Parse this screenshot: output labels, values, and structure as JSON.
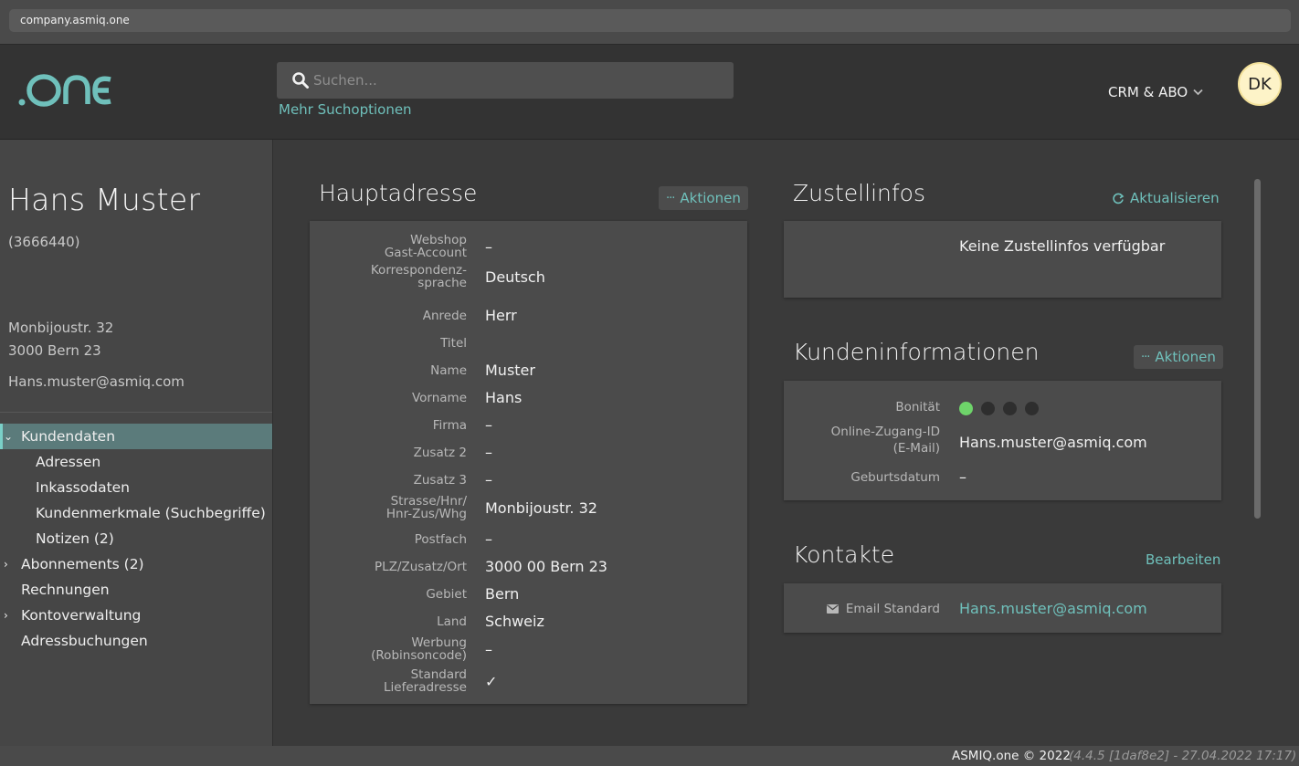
{
  "browser": {
    "url": "company.asmiq.one"
  },
  "header": {
    "logo_text": ".ONE",
    "search_placeholder": "Suchen...",
    "more_search": "Mehr Suchoptionen",
    "module": "CRM & ABO",
    "avatar_initials": "DK"
  },
  "customer": {
    "name": "Hans Muster",
    "id": "(3666440)",
    "street": "Monbijoustr. 32",
    "city": "3000 Bern 23",
    "email": "Hans.muster@asmiq.com"
  },
  "nav": [
    {
      "label": "Kundendaten",
      "chevron": "⌄",
      "active": true
    },
    {
      "label": "Adressen",
      "sub": true
    },
    {
      "label": "Inkassodaten",
      "sub": true
    },
    {
      "label": "Kundenmerkmale (Suchbegriffe)",
      "sub": true
    },
    {
      "label": "Notizen (2)",
      "sub": true
    },
    {
      "label": "Abonnements (2)",
      "chevron": "›"
    },
    {
      "label": "Rechnungen"
    },
    {
      "label": "Kontoverwaltung",
      "chevron": "›"
    },
    {
      "label": "Adressbuchungen"
    }
  ],
  "hauptadresse": {
    "title": "Hauptadresse",
    "action": "Aktionen",
    "rows": [
      {
        "key": "Webshop\nGast-Account",
        "value": "–"
      },
      {
        "key": "Korrespondenz-\nsprache",
        "value": "Deutsch"
      },
      {
        "key": "Anrede",
        "value": "Herr"
      },
      {
        "key": "Titel",
        "value": ""
      },
      {
        "key": "Name",
        "value": "Muster"
      },
      {
        "key": "Vorname",
        "value": "Hans"
      },
      {
        "key": "Firma",
        "value": "–"
      },
      {
        "key": "Zusatz 2",
        "value": "–"
      },
      {
        "key": "Zusatz 3",
        "value": "–"
      },
      {
        "key": "Strasse/Hnr/\nHnr-Zus/Whg",
        "value": "Monbijoustr. 32"
      },
      {
        "key": "Postfach",
        "value": "–"
      },
      {
        "key": "PLZ/Zusatz/Ort",
        "value": "3000 00 Bern 23"
      },
      {
        "key": "Gebiet",
        "value": "Bern"
      },
      {
        "key": "Land",
        "value": "Schweiz"
      },
      {
        "key": "Werbung\n(Robinsoncode)",
        "value": "–"
      },
      {
        "key": "Standard\nLieferadresse",
        "value": "✓"
      }
    ]
  },
  "zustellinfos": {
    "title": "Zustellinfos",
    "action": "Aktualisieren",
    "empty": "Keine Zustellinfos verfügbar"
  },
  "kundeninfo": {
    "title": "Kundeninformationen",
    "action": "Aktionen",
    "bonitaet_label": "Bonität",
    "bonitaet_level": 1,
    "bonitaet_max": 4,
    "colors": {
      "active": "#6ed46a",
      "inactive": "#2e2e2e"
    },
    "online_label": "Online-Zugang-ID\n(E-Mail)",
    "online_value": "Hans.muster@asmiq.com",
    "geburt_label": "Geburtsdatum",
    "geburt_value": "–"
  },
  "kontakte": {
    "title": "Kontakte",
    "action": "Bearbeiten",
    "email_label": "Email Standard",
    "email_value": "Hans.muster@asmiq.com"
  },
  "footer": {
    "copyright": "ASMIQ.one © 2022",
    "version": "(4.4.5 [1daf8e2] - 27.04.2022 17:17)"
  }
}
